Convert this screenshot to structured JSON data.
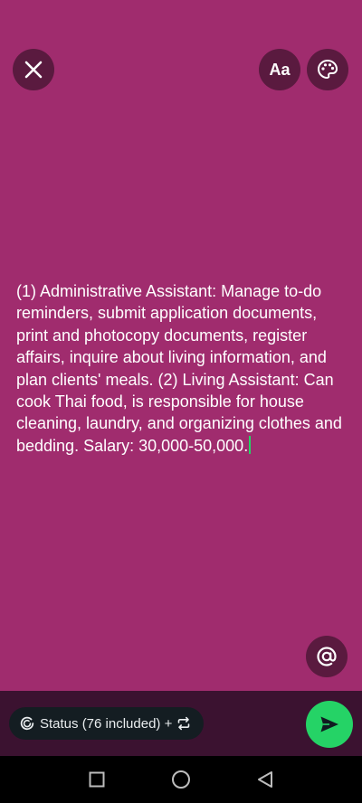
{
  "composer": {
    "background_color": "#A02C6E",
    "font_button_label": "Aa",
    "status_text": "(1) Administrative Assistant: Manage to-do reminders, submit application documents, print and photocopy documents, register affairs, inquire about living information, and plan clients' meals. (2) Living Assistant: Can cook Thai food, is responsible for house cleaning, laundry, and organizing clothes and bedding. Salary: 30,000-50,000."
  },
  "footer": {
    "audience_label": "Status (76 included) +",
    "send_color": "#25D366"
  },
  "icons": [
    "close-icon",
    "palette-icon",
    "mention-icon",
    "status-ring-icon",
    "repeat-icon",
    "send-icon",
    "nav-recents-icon",
    "nav-home-icon",
    "nav-back-icon"
  ]
}
